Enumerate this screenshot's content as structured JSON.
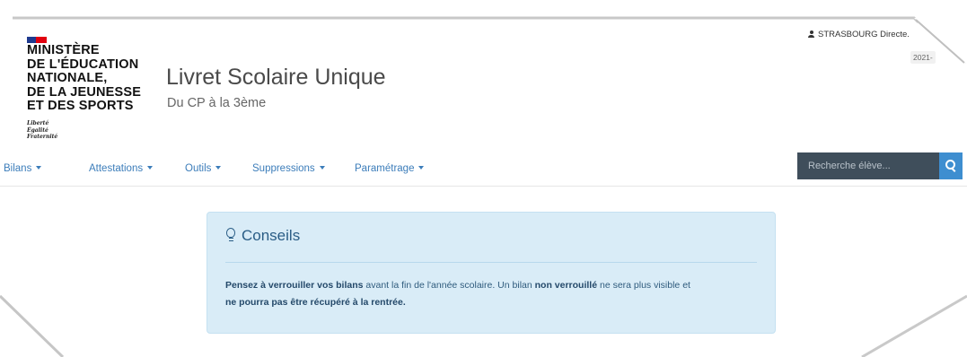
{
  "header": {
    "ministry_lines": "MINISTÈRE\nDE L'ÉDUCATION\nNATIONALE,\nDE LA JEUNESSE\nET DES SPORTS",
    "devise": "Liberté\nÉgalité\nFraternité",
    "app_title": "Livret Scolaire Unique",
    "app_subtitle": "Du CP à la 3ème",
    "user_label": "STRASBOURG Directe.",
    "year_badge": "2021-"
  },
  "nav": {
    "items": [
      {
        "label": "Bilans"
      },
      {
        "label": "Attestations"
      },
      {
        "label": "Outils"
      },
      {
        "label": "Suppressions"
      },
      {
        "label": "Paramétrage"
      }
    ],
    "search_placeholder": "Recherche élève..."
  },
  "alert": {
    "title": "Conseils",
    "part1": "Pensez à verrouiller vos bilans",
    "part2": " avant la fin de l'année scolaire. Un bilan ",
    "part3": "non verrouillé",
    "part4": " ne sera plus visible et ",
    "part5": "ne pourra pas être récupéré à la rentrée."
  },
  "colors": {
    "link": "#3c7dba",
    "alert_bg": "#d9ecf7",
    "search_bg": "#3f4e5b",
    "search_btn": "#3e8ed0",
    "flag_blue": "#1f3a8f",
    "flag_red": "#e1000f"
  },
  "icons": [
    "user-icon",
    "search-icon",
    "lightbulb-icon",
    "caret-down-icon"
  ]
}
